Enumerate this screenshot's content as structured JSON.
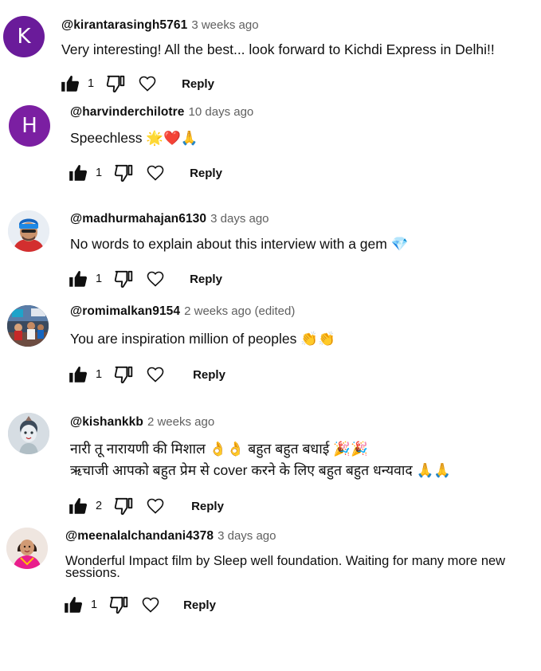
{
  "comments": [
    {
      "author": "@kirantarasingh5761",
      "time": "3 weeks ago",
      "text": "Very interesting! All the best... look forward to Kichdi Express in Delhi!!",
      "likes": "1",
      "reply_label": "Reply",
      "avatar": {
        "type": "letter",
        "letter": "K",
        "color": "#6a1b9a"
      }
    },
    {
      "author": "@harvinderchilotre",
      "time": "10 days ago",
      "text": "Speechless 🌟❤️🙏",
      "likes": "1",
      "reply_label": "Reply",
      "avatar": {
        "type": "letter",
        "letter": "H",
        "color": "#7b1fa2"
      }
    },
    {
      "author": "@madhurmahajan6130",
      "time": "3 days ago",
      "text": "No words to explain about this interview with a gem 💎",
      "likes": "1",
      "reply_label": "Reply",
      "avatar": {
        "type": "photo",
        "name": "man-with-beanie-photo"
      }
    },
    {
      "author": "@romimalkan9154",
      "time": "2 weeks ago (edited)",
      "text": "You are inspiration million of peoples 👏👏",
      "likes": "1",
      "reply_label": "Reply",
      "avatar": {
        "type": "photo",
        "name": "group-room-photo"
      }
    },
    {
      "author": "@kishankkb",
      "time": "2 weeks ago",
      "text": "नारी तू नारायणी की मिशाल 👌👌 बहुत बहुत बधाई 🎉🎉\nऋचाजी आपको बहुत प्रेम से cover करने के लिए बहुत बहुत धन्यवाद 🙏🙏",
      "likes": "2",
      "reply_label": "Reply",
      "avatar": {
        "type": "photo",
        "name": "child-deity-photo"
      }
    },
    {
      "author": "@meenalalchandani4378",
      "time": "3 days ago",
      "text": "Wonderful Impact film by Sleep well foundation. Waiting for many more new sessions.",
      "likes": "1",
      "reply_label": "Reply",
      "avatar": {
        "type": "photo",
        "name": "woman-portrait-photo"
      }
    }
  ]
}
